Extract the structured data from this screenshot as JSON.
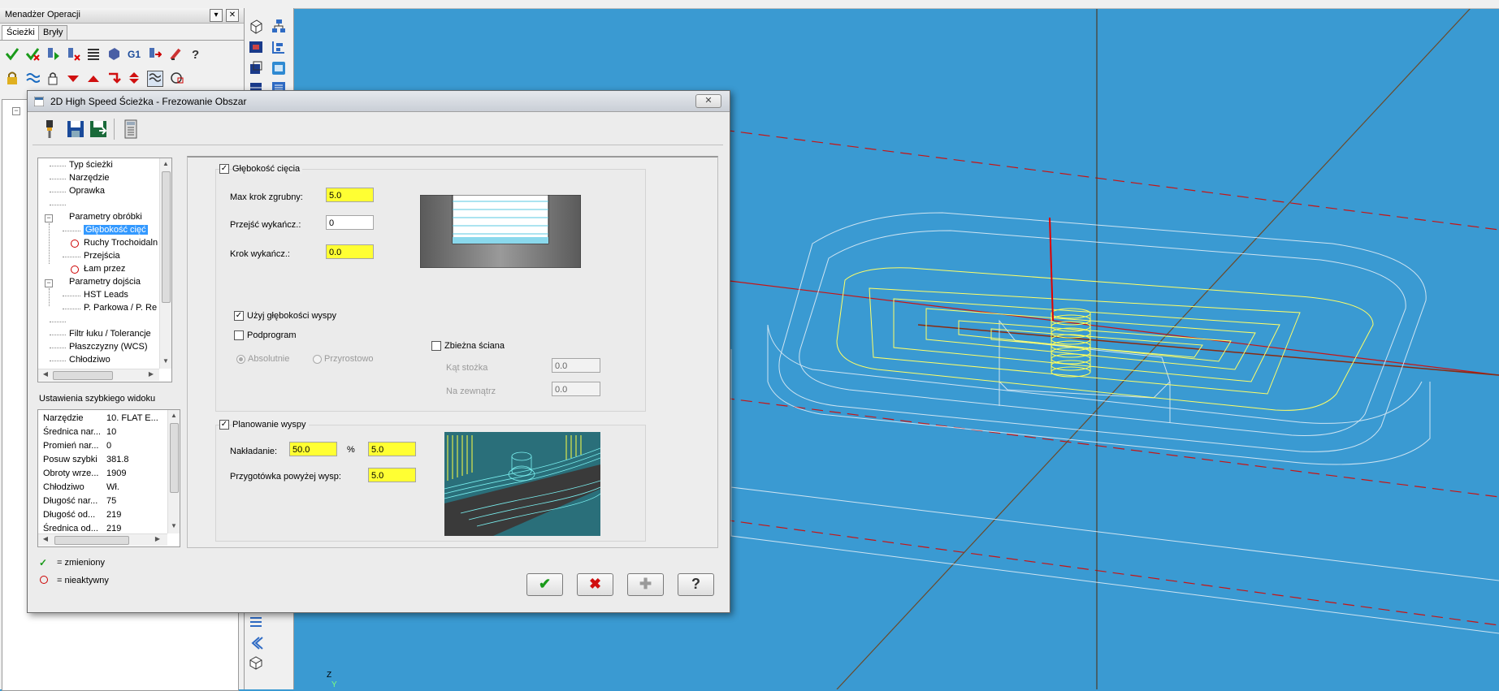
{
  "operations_manager": {
    "title": "Menadżer Operacji",
    "tabs": [
      {
        "label": "Ścieżki"
      },
      {
        "label": "Bryły"
      }
    ]
  },
  "dialog": {
    "title": "2D High Speed Ścieżka - Frezowanie Obszar",
    "close_label": "✕",
    "tree": {
      "items": [
        {
          "label": "Typ ścieżki"
        },
        {
          "label": "Narzędzie"
        },
        {
          "label": "Oprawka"
        },
        {
          "label": ""
        },
        {
          "label": "Parametry obróbki"
        },
        {
          "label": "Głębokość cięć"
        },
        {
          "label": "Ruchy Trochoidaln"
        },
        {
          "label": "Przejścia"
        },
        {
          "label": "Łam przez"
        },
        {
          "label": "Parametry dojścia"
        },
        {
          "label": "HST Leads"
        },
        {
          "label": "P. Parkowa / P. Re"
        },
        {
          "label": ""
        },
        {
          "label": "Filtr łuku / Tolerancje"
        },
        {
          "label": "Płaszczyzny (WCS)"
        },
        {
          "label": "Chłodziwo"
        }
      ]
    },
    "quick_view": {
      "title": "Ustawienia szybkiego widoku",
      "rows": [
        {
          "key": "Narzędzie",
          "value": "10. FLAT E..."
        },
        {
          "key": "Średnica nar...",
          "value": "10"
        },
        {
          "key": "Promień nar...",
          "value": "0"
        },
        {
          "key": "Posuw szybki",
          "value": "381.8"
        },
        {
          "key": "Obroty wrze...",
          "value": "1909"
        },
        {
          "key": "Chłodziwo",
          "value": "Wł."
        },
        {
          "key": "Długość nar...",
          "value": "75"
        },
        {
          "key": "Długość od...",
          "value": "219"
        },
        {
          "key": "Średnica od...",
          "value": "219"
        }
      ]
    },
    "legend": {
      "changed": "= zmieniony",
      "inactive": "= nieaktywny"
    },
    "depth_group": {
      "title": "Głębokość cięcia",
      "checked": true,
      "max_rough_label": "Max krok zgrubny:",
      "max_rough_value": "5.0",
      "finish_passes_label": "Przejść wykańcz.:",
      "finish_passes_value": "0",
      "finish_step_label": "Krok wykańcz.:",
      "finish_step_value": "0.0",
      "use_island_depth_label": "Użyj głębokości wyspy",
      "use_island_depth_checked": true,
      "subprogram_label": "Podprogram",
      "subprogram_checked": false,
      "absolute_label": "Absolutnie",
      "incremental_label": "Przyrostowo",
      "tapered_wall_label": "Zbieżna ściana",
      "tapered_wall_checked": false,
      "taper_angle_label": "Kąt stożka",
      "taper_angle_value": "0.0",
      "outside_label": "Na zewnątrz",
      "outside_value": "0.0"
    },
    "island_group": {
      "title": "Planowanie wyspy",
      "checked": true,
      "overlap_label": "Nakładanie:",
      "overlap_percent": "50.0",
      "percent_symbol": "%",
      "overlap_value": "5.0",
      "stock_above_label": "Przygotówka powyżej wysp:",
      "stock_above_value": "5.0"
    },
    "buttons": {
      "ok": "✔",
      "cancel": "✖",
      "add": "✚",
      "help": "?"
    }
  },
  "viewport": {
    "axis_z": "Z",
    "axis_y": "Y"
  },
  "colors": {
    "viewport_bg": "#3a9ad2",
    "selection": "#3399ff",
    "input_highlight": "#ffff33",
    "toolpath": "#ffff66"
  }
}
